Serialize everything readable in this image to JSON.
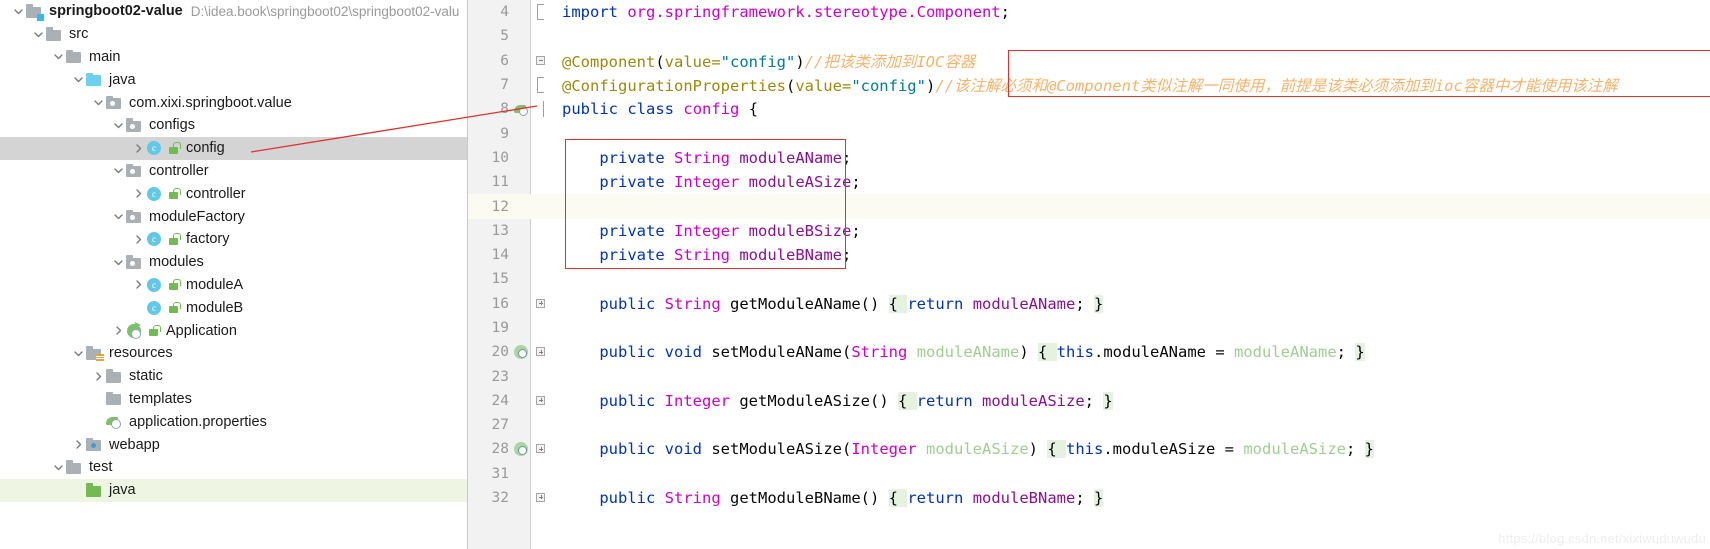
{
  "project_tree": {
    "name": "project-tool-window",
    "rows": [
      {
        "indent": 0,
        "twisty": "down",
        "icon": "module-folder-icon",
        "lock": false,
        "label": "springboot02-value",
        "bold": true,
        "path": "D:\\idea.book\\springboot02\\springboot02-valu",
        "state": "normal"
      },
      {
        "indent": 1,
        "twisty": "down",
        "icon": "folder-icon",
        "lock": false,
        "label": "src",
        "bold": false,
        "path": "",
        "state": "normal"
      },
      {
        "indent": 2,
        "twisty": "down",
        "icon": "folder-icon",
        "lock": false,
        "label": "main",
        "bold": false,
        "path": "",
        "state": "normal"
      },
      {
        "indent": 3,
        "twisty": "down",
        "icon": "source-folder-icon",
        "lock": false,
        "label": "java",
        "bold": false,
        "path": "",
        "state": "normal"
      },
      {
        "indent": 4,
        "twisty": "down",
        "icon": "package-icon",
        "lock": false,
        "label": "com.xixi.springboot.value",
        "bold": false,
        "path": "",
        "state": "normal"
      },
      {
        "indent": 5,
        "twisty": "down",
        "icon": "package-icon",
        "lock": false,
        "label": "configs",
        "bold": false,
        "path": "",
        "state": "normal"
      },
      {
        "indent": 6,
        "twisty": "right",
        "icon": "java-class-icon",
        "lock": true,
        "label": "config",
        "bold": false,
        "path": "",
        "state": "selected"
      },
      {
        "indent": 5,
        "twisty": "down",
        "icon": "package-icon",
        "lock": false,
        "label": "controller",
        "bold": false,
        "path": "",
        "state": "normal"
      },
      {
        "indent": 6,
        "twisty": "right",
        "icon": "java-class-icon",
        "lock": true,
        "label": "controller",
        "bold": false,
        "path": "",
        "state": "normal"
      },
      {
        "indent": 5,
        "twisty": "down",
        "icon": "package-icon",
        "lock": false,
        "label": "moduleFactory",
        "bold": false,
        "path": "",
        "state": "normal"
      },
      {
        "indent": 6,
        "twisty": "right",
        "icon": "java-class-icon",
        "lock": true,
        "label": "factory",
        "bold": false,
        "path": "",
        "state": "normal"
      },
      {
        "indent": 5,
        "twisty": "down",
        "icon": "package-icon",
        "lock": false,
        "label": "modules",
        "bold": false,
        "path": "",
        "state": "normal"
      },
      {
        "indent": 6,
        "twisty": "right",
        "icon": "java-class-icon",
        "lock": true,
        "label": "moduleA",
        "bold": false,
        "path": "",
        "state": "normal"
      },
      {
        "indent": 6,
        "twisty": "none",
        "icon": "java-class-icon",
        "lock": true,
        "label": "moduleB",
        "bold": false,
        "path": "",
        "state": "normal"
      },
      {
        "indent": 5,
        "twisty": "right",
        "icon": "spring-application-icon",
        "lock": true,
        "label": "Application",
        "bold": false,
        "path": "",
        "state": "normal"
      },
      {
        "indent": 3,
        "twisty": "down",
        "icon": "resources-folder-icon",
        "lock": false,
        "label": "resources",
        "bold": false,
        "path": "",
        "state": "normal"
      },
      {
        "indent": 4,
        "twisty": "right",
        "icon": "folder-icon",
        "lock": false,
        "label": "static",
        "bold": false,
        "path": "",
        "state": "normal"
      },
      {
        "indent": 4,
        "twisty": "none",
        "icon": "folder-icon",
        "lock": false,
        "label": "templates",
        "bold": false,
        "path": "",
        "state": "normal"
      },
      {
        "indent": 4,
        "twisty": "none",
        "icon": "properties-file-icon",
        "lock": false,
        "label": "application.properties",
        "bold": false,
        "path": "",
        "state": "normal"
      },
      {
        "indent": 3,
        "twisty": "right",
        "icon": "webapp-folder-icon",
        "lock": false,
        "label": "webapp",
        "bold": false,
        "path": "",
        "state": "normal"
      },
      {
        "indent": 2,
        "twisty": "down",
        "icon": "folder-icon",
        "lock": false,
        "label": "test",
        "bold": false,
        "path": "",
        "state": "normal"
      },
      {
        "indent": 3,
        "twisty": "none",
        "icon": "test-source-folder-icon",
        "lock": false,
        "label": "java",
        "bold": false,
        "path": "",
        "state": "test-source-root"
      }
    ]
  },
  "editor": {
    "name": "code-editor",
    "file": "config.java",
    "lines": [
      {
        "number": "4",
        "gutter_icon": "",
        "fold": "fold-bracket",
        "caret": false,
        "tokens": [
          {
            "t": "import",
            "c": "kw"
          },
          {
            "t": " ",
            "c": "ident"
          },
          {
            "t": "org.springframework.stereotype.Component",
            "c": "cls"
          },
          {
            "t": ";",
            "c": "ident"
          }
        ]
      },
      {
        "number": "5",
        "gutter_icon": "",
        "fold": "",
        "caret": false,
        "tokens": []
      },
      {
        "number": "6",
        "gutter_icon": "",
        "fold": "fold-collapse",
        "caret": false,
        "tokens": [
          {
            "t": "@Component",
            "c": "ann"
          },
          {
            "t": "(",
            "c": "ident"
          },
          {
            "t": "value=",
            "c": "ann"
          },
          {
            "t": "\"config\"",
            "c": "str"
          },
          {
            "t": ")",
            "c": "ident"
          },
          {
            "t": "//把该类添加到IOC容器",
            "c": "cmt"
          }
        ]
      },
      {
        "number": "7",
        "gutter_icon": "",
        "fold": "fold-bracket",
        "caret": false,
        "tokens": [
          {
            "t": "@ConfigurationProperties",
            "c": "ann"
          },
          {
            "t": "(",
            "c": "ident"
          },
          {
            "t": "value=",
            "c": "ann"
          },
          {
            "t": "\"config\"",
            "c": "str"
          },
          {
            "t": ")",
            "c": "ident"
          },
          {
            "t": "//该注解必须和@Component类似注解一同使用，前提是该类必须添加到ioc容器中才能使用该注解",
            "c": "cmt"
          }
        ]
      },
      {
        "number": "8",
        "gutter_icon": "spring-bean-gutter-icon",
        "fold": "fold-line",
        "caret": false,
        "tokens": [
          {
            "t": "public",
            "c": "kw"
          },
          {
            "t": " ",
            "c": "ident"
          },
          {
            "t": "class",
            "c": "kw"
          },
          {
            "t": " ",
            "c": "ident"
          },
          {
            "t": "config",
            "c": "cls"
          },
          {
            "t": " {",
            "c": "ident"
          }
        ]
      },
      {
        "number": "9",
        "gutter_icon": "",
        "fold": "",
        "caret": false,
        "tokens": []
      },
      {
        "number": "10",
        "gutter_icon": "",
        "fold": "",
        "caret": false,
        "tokens": [
          {
            "t": "    ",
            "c": "ident"
          },
          {
            "t": "private",
            "c": "kw"
          },
          {
            "t": " ",
            "c": "ident"
          },
          {
            "t": "String",
            "c": "cls"
          },
          {
            "t": " ",
            "c": "ident"
          },
          {
            "t": "moduleAName",
            "c": "field"
          },
          {
            "t": ";",
            "c": "ident"
          }
        ]
      },
      {
        "number": "11",
        "gutter_icon": "",
        "fold": "",
        "caret": false,
        "tokens": [
          {
            "t": "    ",
            "c": "ident"
          },
          {
            "t": "private",
            "c": "kw"
          },
          {
            "t": " ",
            "c": "ident"
          },
          {
            "t": "Integer",
            "c": "cls"
          },
          {
            "t": " ",
            "c": "ident"
          },
          {
            "t": "moduleASize",
            "c": "field"
          },
          {
            "t": ";",
            "c": "ident"
          }
        ]
      },
      {
        "number": "12",
        "gutter_icon": "",
        "fold": "",
        "caret": true,
        "tokens": []
      },
      {
        "number": "13",
        "gutter_icon": "",
        "fold": "",
        "caret": false,
        "tokens": [
          {
            "t": "    ",
            "c": "ident"
          },
          {
            "t": "private",
            "c": "kw"
          },
          {
            "t": " ",
            "c": "ident"
          },
          {
            "t": "Integer",
            "c": "cls"
          },
          {
            "t": " ",
            "c": "ident"
          },
          {
            "t": "moduleBSize",
            "c": "field"
          },
          {
            "t": ";",
            "c": "ident"
          }
        ]
      },
      {
        "number": "14",
        "gutter_icon": "",
        "fold": "",
        "caret": false,
        "tokens": [
          {
            "t": "    ",
            "c": "ident"
          },
          {
            "t": "private",
            "c": "kw"
          },
          {
            "t": " ",
            "c": "ident"
          },
          {
            "t": "String",
            "c": "cls"
          },
          {
            "t": " ",
            "c": "ident"
          },
          {
            "t": "moduleBName",
            "c": "field"
          },
          {
            "t": ";",
            "c": "ident"
          }
        ]
      },
      {
        "number": "15",
        "gutter_icon": "",
        "fold": "",
        "caret": false,
        "tokens": []
      },
      {
        "number": "16",
        "gutter_icon": "",
        "fold": "fold-expand",
        "caret": false,
        "tokens": [
          {
            "t": "    ",
            "c": "ident"
          },
          {
            "t": "public",
            "c": "kw"
          },
          {
            "t": " ",
            "c": "ident"
          },
          {
            "t": "String",
            "c": "cls"
          },
          {
            "t": " ",
            "c": "ident"
          },
          {
            "t": "getModuleAName",
            "c": "ident"
          },
          {
            "t": "() ",
            "c": "ident"
          },
          {
            "t": "{ ",
            "c": "hl"
          },
          {
            "t": "return",
            "c": "kw"
          },
          {
            "t": " ",
            "c": "ident"
          },
          {
            "t": "moduleAName",
            "c": "field"
          },
          {
            "t": "; ",
            "c": "ident"
          },
          {
            "t": "}",
            "c": "hl"
          }
        ]
      },
      {
        "number": "19",
        "gutter_icon": "",
        "fold": "",
        "caret": false,
        "tokens": []
      },
      {
        "number": "20",
        "gutter_icon": "bean-gutter-icon",
        "fold": "fold-expand",
        "caret": false,
        "tokens": [
          {
            "t": "    ",
            "c": "ident"
          },
          {
            "t": "public",
            "c": "kw"
          },
          {
            "t": " ",
            "c": "ident"
          },
          {
            "t": "void",
            "c": "kw"
          },
          {
            "t": " ",
            "c": "ident"
          },
          {
            "t": "setModuleAName",
            "c": "ident"
          },
          {
            "t": "(",
            "c": "ident"
          },
          {
            "t": "String",
            "c": "cls"
          },
          {
            "t": " ",
            "c": "ident"
          },
          {
            "t": "moduleAName",
            "c": "param"
          },
          {
            "t": ") ",
            "c": "ident"
          },
          {
            "t": "{ ",
            "c": "hl"
          },
          {
            "t": "this",
            "c": "kw"
          },
          {
            "t": ".moduleAName",
            "c": "ident"
          },
          {
            "t": " = ",
            "c": "ident"
          },
          {
            "t": "moduleAName",
            "c": "param"
          },
          {
            "t": "; ",
            "c": "ident"
          },
          {
            "t": "}",
            "c": "hl"
          }
        ]
      },
      {
        "number": "23",
        "gutter_icon": "",
        "fold": "",
        "caret": false,
        "tokens": []
      },
      {
        "number": "24",
        "gutter_icon": "",
        "fold": "fold-expand",
        "caret": false,
        "tokens": [
          {
            "t": "    ",
            "c": "ident"
          },
          {
            "t": "public",
            "c": "kw"
          },
          {
            "t": " ",
            "c": "ident"
          },
          {
            "t": "Integer",
            "c": "cls"
          },
          {
            "t": " ",
            "c": "ident"
          },
          {
            "t": "getModuleASize",
            "c": "ident"
          },
          {
            "t": "() ",
            "c": "ident"
          },
          {
            "t": "{ ",
            "c": "hl"
          },
          {
            "t": "return",
            "c": "kw"
          },
          {
            "t": " ",
            "c": "ident"
          },
          {
            "t": "moduleASize",
            "c": "field"
          },
          {
            "t": "; ",
            "c": "ident"
          },
          {
            "t": "}",
            "c": "hl"
          }
        ]
      },
      {
        "number": "27",
        "gutter_icon": "",
        "fold": "",
        "caret": false,
        "tokens": []
      },
      {
        "number": "28",
        "gutter_icon": "bean-gutter-icon",
        "fold": "fold-expand",
        "caret": false,
        "tokens": [
          {
            "t": "    ",
            "c": "ident"
          },
          {
            "t": "public",
            "c": "kw"
          },
          {
            "t": " ",
            "c": "ident"
          },
          {
            "t": "void",
            "c": "kw"
          },
          {
            "t": " ",
            "c": "ident"
          },
          {
            "t": "setModuleASize",
            "c": "ident"
          },
          {
            "t": "(",
            "c": "ident"
          },
          {
            "t": "Integer",
            "c": "cls"
          },
          {
            "t": " ",
            "c": "ident"
          },
          {
            "t": "moduleASize",
            "c": "param"
          },
          {
            "t": ") ",
            "c": "ident"
          },
          {
            "t": "{ ",
            "c": "hl"
          },
          {
            "t": "this",
            "c": "kw"
          },
          {
            "t": ".moduleASize",
            "c": "ident"
          },
          {
            "t": " = ",
            "c": "ident"
          },
          {
            "t": "moduleASize",
            "c": "param"
          },
          {
            "t": "; ",
            "c": "ident"
          },
          {
            "t": "}",
            "c": "hl"
          }
        ]
      },
      {
        "number": "31",
        "gutter_icon": "",
        "fold": "",
        "caret": false,
        "tokens": []
      },
      {
        "number": "32",
        "gutter_icon": "",
        "fold": "fold-expand",
        "caret": false,
        "tokens": [
          {
            "t": "    ",
            "c": "ident"
          },
          {
            "t": "public",
            "c": "kw"
          },
          {
            "t": " ",
            "c": "ident"
          },
          {
            "t": "String",
            "c": "cls"
          },
          {
            "t": " ",
            "c": "ident"
          },
          {
            "t": "getModuleBName",
            "c": "ident"
          },
          {
            "t": "() ",
            "c": "ident"
          },
          {
            "t": "{ ",
            "c": "hl"
          },
          {
            "t": "return",
            "c": "kw"
          },
          {
            "t": " ",
            "c": "ident"
          },
          {
            "t": "moduleBName",
            "c": "field"
          },
          {
            "t": "; ",
            "c": "ident"
          },
          {
            "t": "}",
            "c": "hl"
          }
        ]
      }
    ]
  },
  "annotations": {
    "red_box_annotations_name": "red-highlight-box-annotations",
    "red_box_fields_name": "red-highlight-box-fields",
    "red_arrow_name": "red-pointer-arrow"
  },
  "watermark": {
    "text": "https://blog.csdn.net/xixiwuduwudu"
  },
  "colors": {
    "selection": "#d4d4d4",
    "test_source_root": "#eef6e3",
    "caret_line": "#fcfbf2",
    "highlight_brace": "#e5f2e0",
    "red_annotation": "#e03030",
    "gutter_bg": "#f2f2f2",
    "keyword": "#0033b3",
    "class_name": "#cc00cc",
    "string": "#007a9e",
    "annotation_token": "#9e880d",
    "comment": "#f5b36b",
    "field": "#871094",
    "parameter": "#9dcf8f"
  }
}
